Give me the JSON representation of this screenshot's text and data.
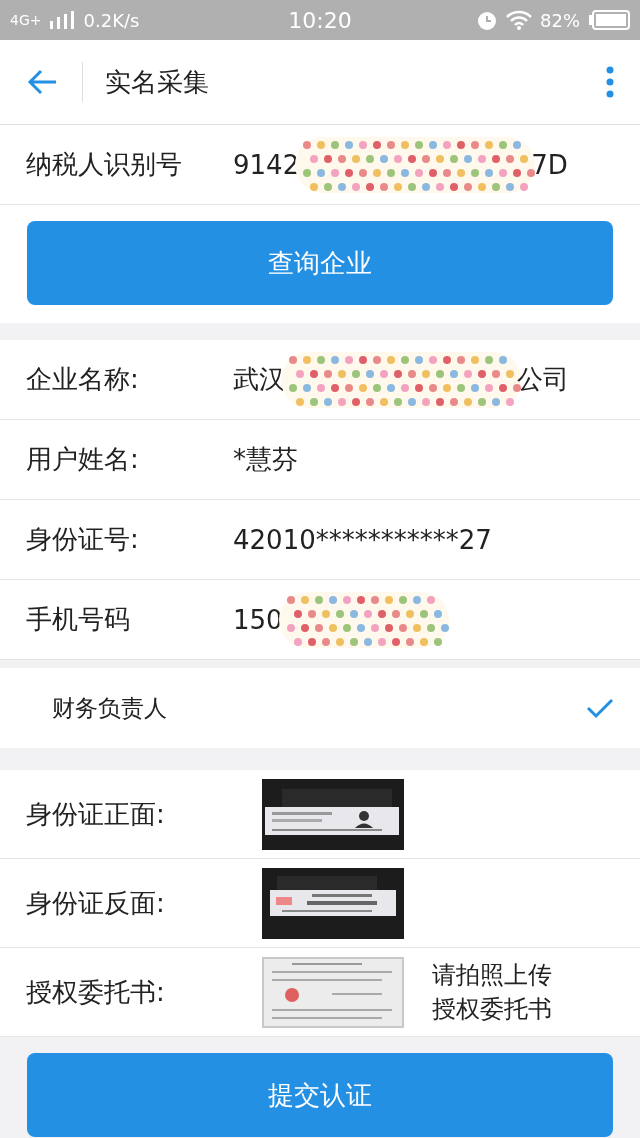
{
  "status_bar": {
    "network": "4G+",
    "speed": "0.2K/s",
    "time": "10:20",
    "battery": "82%"
  },
  "header": {
    "title": "实名采集"
  },
  "taxpayer": {
    "label": "纳税人识别号",
    "value_start": "9142",
    "value_end": "7D",
    "masked": true
  },
  "query_button": "查询企业",
  "fields": [
    {
      "label": "企业名称:",
      "value_start": "武汉",
      "value_end": "公司",
      "masked": true
    },
    {
      "label": "用户姓名:",
      "value_start": "*慧芬",
      "masked": false
    },
    {
      "label": "身份证号:",
      "value_start": "42010***********27",
      "masked": false
    },
    {
      "label": "手机号码",
      "value_start": "150",
      "masked": true
    }
  ],
  "role": {
    "label": "财务负责人",
    "selected": true
  },
  "uploads": [
    {
      "label": "身份证正面:",
      "kind": "front"
    },
    {
      "label": "身份证反面:",
      "kind": "back"
    },
    {
      "label": "授权委托书:",
      "kind": "letter",
      "hint": [
        "请拍照上传",
        "授权委托书"
      ]
    }
  ],
  "submit_button": "提交认证"
}
